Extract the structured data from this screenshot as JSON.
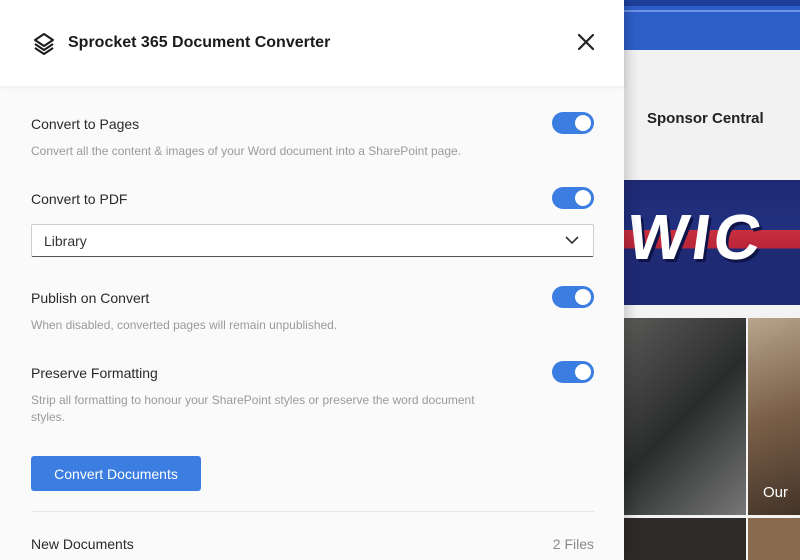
{
  "header": {
    "title": "Sprocket 365 Document Converter",
    "logo_icon": "sprocket-logo-icon",
    "close_icon": "close-icon"
  },
  "options": [
    {
      "title": "Convert to Pages",
      "description": "Convert all the content & images of your Word document into a SharePoint page.",
      "enabled": true
    },
    {
      "title": "Convert to PDF",
      "description": "",
      "enabled": true
    },
    {
      "title": "Publish on Convert",
      "description": "When disabled, converted pages will remain unpublished.",
      "enabled": true
    },
    {
      "title": "Preserve Formatting",
      "description": "Strip all formatting to honour your SharePoint styles or preserve the word document styles.",
      "enabled": true
    }
  ],
  "pdf_library_select": {
    "value": "Library",
    "icon": "chevron-down-icon"
  },
  "convert_button": {
    "label": "Convert Documents"
  },
  "new_documents": {
    "label": "New Documents",
    "count_label": "2 Files"
  },
  "background_page": {
    "nav_label": "Sponsor Central",
    "hero_text": "WIC",
    "tile_caption": "Our"
  },
  "colors": {
    "accent": "#3b7de0",
    "panel_bg": "#fafafa",
    "header_bg": "#ffffff"
  }
}
